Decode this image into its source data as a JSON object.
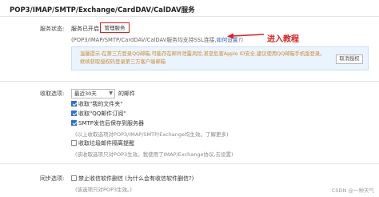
{
  "page": {
    "title": "POP3/IMAP/SMTP/Exchange/CardDAV/CalDAV服务"
  },
  "service_status": {
    "label": "服务状态:",
    "status_text": "服务已开启",
    "manage_button_label": "管理服务",
    "config_text": "(POP3/IMAP/SMTP/CardDAV/CalDAV服务均支持SSL连接,",
    "config_link": "如何设置",
    "config_text_end": "?)"
  },
  "annotation": {
    "text": "进入教程",
    "color": "#e02020"
  },
  "notice": {
    "text": "温馨提示:在第三方登录QQ邮箱,可能存在邮件泄露风险,甚至危害Apple ID安全,建议使用QQ邮箱手机版登录。 继续获取授权码登录第三方客户端邮箱",
    "close_label": "取消授权"
  },
  "receive_options": {
    "label": "收取选项:",
    "select_value": "最近30天",
    "select_suffix": "的邮件",
    "options": [
      {
        "label": "收取\"我的文件夹\"",
        "checked": true
      },
      {
        "label": "收取\"QQ邮件订阅\"",
        "checked": true
      },
      {
        "label": "SMTP发信后保存到服务器",
        "checked": true
      }
    ],
    "hint_1": "(以上收取选项对POP3/IMAP/SMTP/Exchange均生效。了解更多)",
    "spam_option": {
      "label": "收取垃圾邮件隔离提醒",
      "checked": false
    },
    "hint_2": "(该收取选项只对POP3生效。我使用了IMAP/Exchange协议,去设置)"
  },
  "sync_options": {
    "label": "同步选项:",
    "option": {
      "label": "禁止收信软件删信 (为什么会有收信软件删信?)",
      "checked": false
    },
    "hint": "(该选项只对POP3生效。)"
  },
  "watermark": "CSDN @一种天气"
}
